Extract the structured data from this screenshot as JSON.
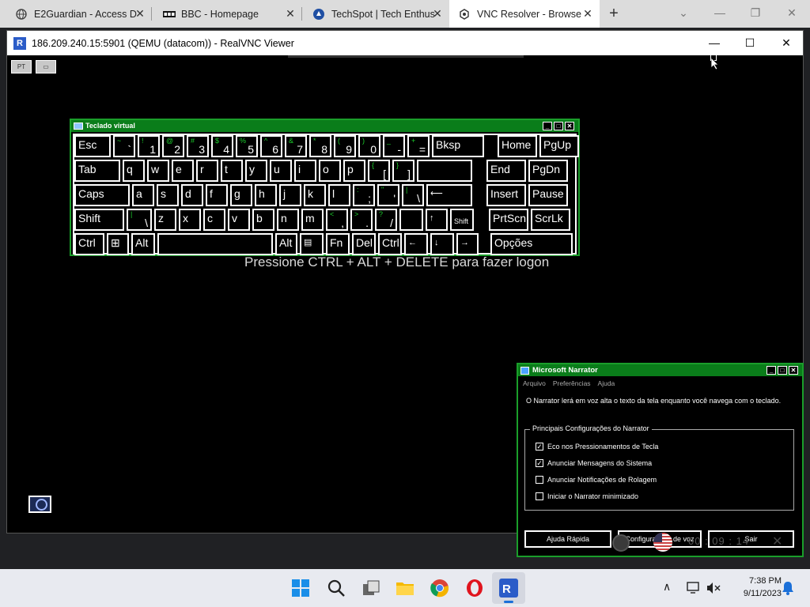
{
  "browser": {
    "tabs": [
      {
        "title": "E2Guardian - Access D",
        "icon": "globe-icon"
      },
      {
        "title": "BBC - Homepage",
        "icon": "bbc-icon"
      },
      {
        "title": "TechSpot | Tech Enthus",
        "icon": "techspot-icon"
      },
      {
        "title": "VNC Resolver - Browse",
        "icon": "vnc-resolver-icon"
      }
    ],
    "new_tab": "+",
    "close": "✕",
    "minimize": "—",
    "restore": "❐"
  },
  "vnc": {
    "title": "186.209.240.15:5901 (QEMU (datacom)) - RealVNC Viewer",
    "logo": "R",
    "minimize": "—",
    "maximize": "☐",
    "close": "✕",
    "btn_pt": "PT",
    "btn_kb": "▭"
  },
  "keyboard": {
    "title": "Teclado virtual",
    "rows": [
      [
        {
          "l": "Esc"
        },
        {
          "s": "~",
          "p": "`"
        },
        {
          "s": "!",
          "p": "1"
        },
        {
          "s": "@",
          "p": "2"
        },
        {
          "s": "#",
          "p": "3"
        },
        {
          "s": "$",
          "p": "4"
        },
        {
          "s": "%",
          "p": "5"
        },
        {
          "s": "^",
          "p": "6"
        },
        {
          "s": "&",
          "p": "7"
        },
        {
          "s": "*",
          "p": "8"
        },
        {
          "s": "(",
          "p": "9"
        },
        {
          "s": ")",
          "p": "0"
        },
        {
          "s": "_",
          "p": "-"
        },
        {
          "s": "+",
          "p": "="
        },
        {
          "l": "Bksp"
        },
        {
          "l": "Home"
        },
        {
          "l": "PgUp"
        }
      ],
      [
        {
          "l": "Tab"
        },
        {
          "l": "q"
        },
        {
          "l": "w"
        },
        {
          "l": "e"
        },
        {
          "l": "r"
        },
        {
          "l": "t"
        },
        {
          "l": "y"
        },
        {
          "l": "u"
        },
        {
          "l": "i"
        },
        {
          "l": "o"
        },
        {
          "l": "p"
        },
        {
          "s": "{",
          "p": "["
        },
        {
          "s": "}",
          "p": "]"
        },
        {
          "l": ""
        },
        {
          "l": "End"
        },
        {
          "l": "PgDn"
        }
      ],
      [
        {
          "l": "Caps"
        },
        {
          "l": "a"
        },
        {
          "l": "s"
        },
        {
          "l": "d"
        },
        {
          "l": "f"
        },
        {
          "l": "g"
        },
        {
          "l": "h"
        },
        {
          "l": "j"
        },
        {
          "l": "k"
        },
        {
          "l": "l"
        },
        {
          "s": ":",
          "p": ";"
        },
        {
          "s": "\"",
          "p": "'"
        },
        {
          "s": "|",
          "p": "\\"
        },
        {
          "l": "⟵"
        },
        {
          "l": "Insert"
        },
        {
          "l": "Pause"
        }
      ],
      [
        {
          "l": "Shift"
        },
        {
          "s": "|",
          "p": "\\"
        },
        {
          "l": "z"
        },
        {
          "l": "x"
        },
        {
          "l": "c"
        },
        {
          "l": "v"
        },
        {
          "l": "b"
        },
        {
          "l": "n"
        },
        {
          "l": "m"
        },
        {
          "s": "<",
          "p": ","
        },
        {
          "s": ">",
          "p": "."
        },
        {
          "s": "?",
          "p": "/"
        },
        {
          "l": ""
        },
        {
          "l": "↑"
        },
        {
          "l": "Shift"
        },
        {
          "l": "PrtScn"
        },
        {
          "l": "ScrLk"
        }
      ],
      [
        {
          "l": "Ctrl"
        },
        {
          "l": "⊞"
        },
        {
          "l": "Alt"
        },
        {
          "l": ""
        },
        {
          "l": "Alt"
        },
        {
          "l": "▤"
        },
        {
          "l": "Fn"
        },
        {
          "l": "Del"
        },
        {
          "l": "Ctrl"
        },
        {
          "l": "←"
        },
        {
          "l": "↓"
        },
        {
          "l": "→"
        },
        {
          "l": "Opções"
        }
      ]
    ]
  },
  "logon_message": "Pressione CTRL + ALT + DELETE para fazer logon",
  "narrator": {
    "title": "Microsoft Narrator",
    "menu": [
      "Arquivo",
      "Preferências",
      "Ajuda"
    ],
    "description": "O Narrator lerá em voz alta o texto da tela enquanto você navega com o teclado.",
    "group_label": "Principais Configurações do Narrator",
    "options": [
      {
        "label": "Eco nos Pressionamentos de Tecla",
        "checked": true
      },
      {
        "label": "Anunciar Mensagens do Sistema",
        "checked": true
      },
      {
        "label": "Anunciar Notificações de Rolagem",
        "checked": false
      },
      {
        "label": "Iniciar o Narrator minimizado",
        "checked": false
      }
    ],
    "buttons": {
      "help": "Ajuda Rápida",
      "voice": "Configurações de voz",
      "exit": "Sair"
    }
  },
  "floating_toolbar": {
    "timer": "00 : 09 : 14",
    "close": "✕"
  },
  "taskbar": {
    "time": "7:38 PM",
    "date": "9/11/2023",
    "tray_chevron": "∧"
  }
}
